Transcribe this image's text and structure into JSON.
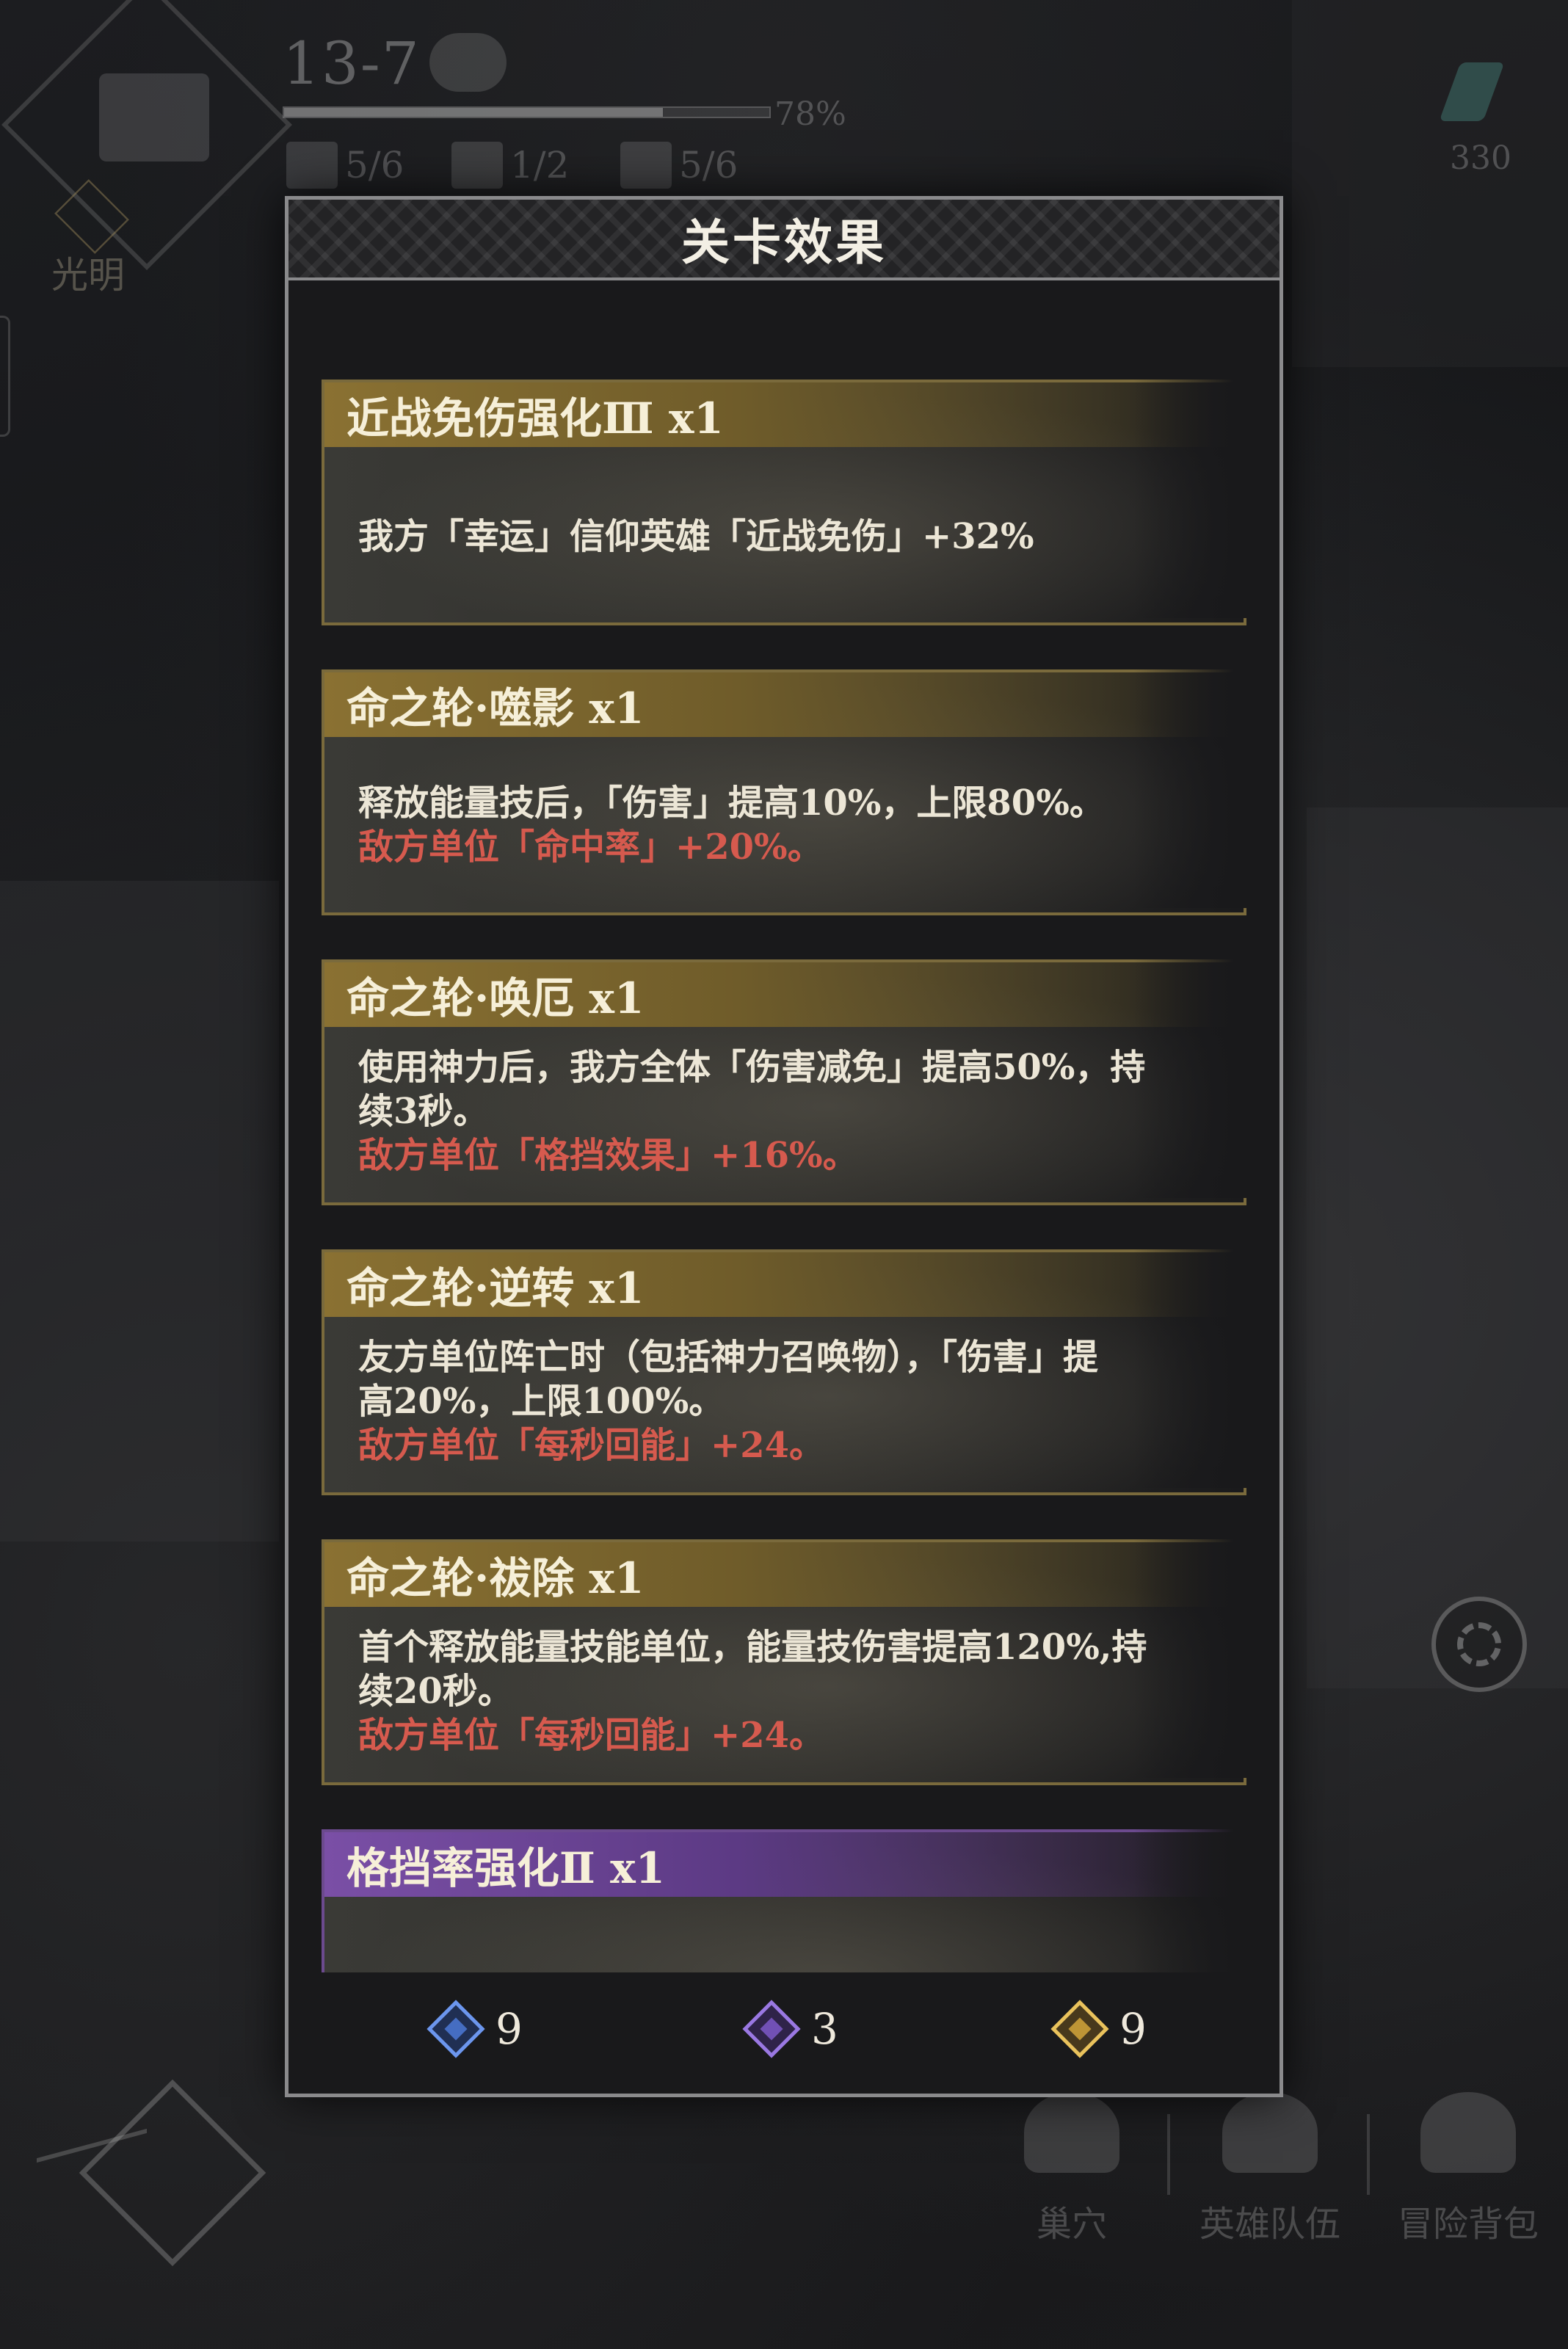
{
  "hud": {
    "stage": "13-7",
    "progress_label": "78%",
    "progress_value": 0.78,
    "faction_label": "光明",
    "stats": [
      {
        "icon": "crossed-swords-icon",
        "value": "5/6"
      },
      {
        "icon": "chest-icon",
        "value": "1/2"
      },
      {
        "icon": "scroll-icon",
        "value": "5/6"
      }
    ],
    "right_counter": "330"
  },
  "modal": {
    "title": "关卡效果",
    "effects": [
      {
        "title": "近战免伤强化Ⅲ x1",
        "tier": "gold",
        "lines": [
          "我方「幸运」信仰英雄「近战免伤」+32%"
        ],
        "enemy": ""
      },
      {
        "title": "命之轮·噬影 x1",
        "tier": "gold",
        "lines": [
          "释放能量技后，「伤害」提高10%，上限80%。"
        ],
        "enemy": "敌方单位「命中率」+20%。"
      },
      {
        "title": "命之轮·唤厄 x1",
        "tier": "gold",
        "lines": [
          "使用神力后，我方全体「伤害减免」提高50%，持",
          "续3秒。"
        ],
        "enemy": "敌方单位「格挡效果」+16%。"
      },
      {
        "title": "命之轮·逆转 x1",
        "tier": "gold",
        "lines": [
          "友方单位阵亡时（包括神力召唤物），「伤害」提",
          "高20%，上限100%。"
        ],
        "enemy": "敌方单位「每秒回能」+24。"
      },
      {
        "title": "命之轮·祓除 x1",
        "tier": "gold",
        "lines": [
          "首个释放能量技能单位，能量技伤害提高120%,持",
          "续20秒。"
        ],
        "enemy": "敌方单位「每秒回能」+24。"
      },
      {
        "title": "格挡率强化Ⅱ x1",
        "tier": "purple",
        "lines": [],
        "enemy": ""
      }
    ],
    "resources": [
      {
        "icon": "blue-gem-icon",
        "color": "#4c78d6",
        "count": "9"
      },
      {
        "icon": "purple-gem-icon",
        "color": "#7c58c8",
        "count": "3"
      },
      {
        "icon": "gold-gem-icon",
        "color": "#d4a63a",
        "count": "9"
      }
    ]
  },
  "bottom_menu": [
    {
      "icon": "nest-icon",
      "label": "巢穴"
    },
    {
      "icon": "hero-team-icon",
      "label": "英雄队伍"
    },
    {
      "icon": "backpack-icon",
      "label": "冒险背包"
    }
  ]
}
